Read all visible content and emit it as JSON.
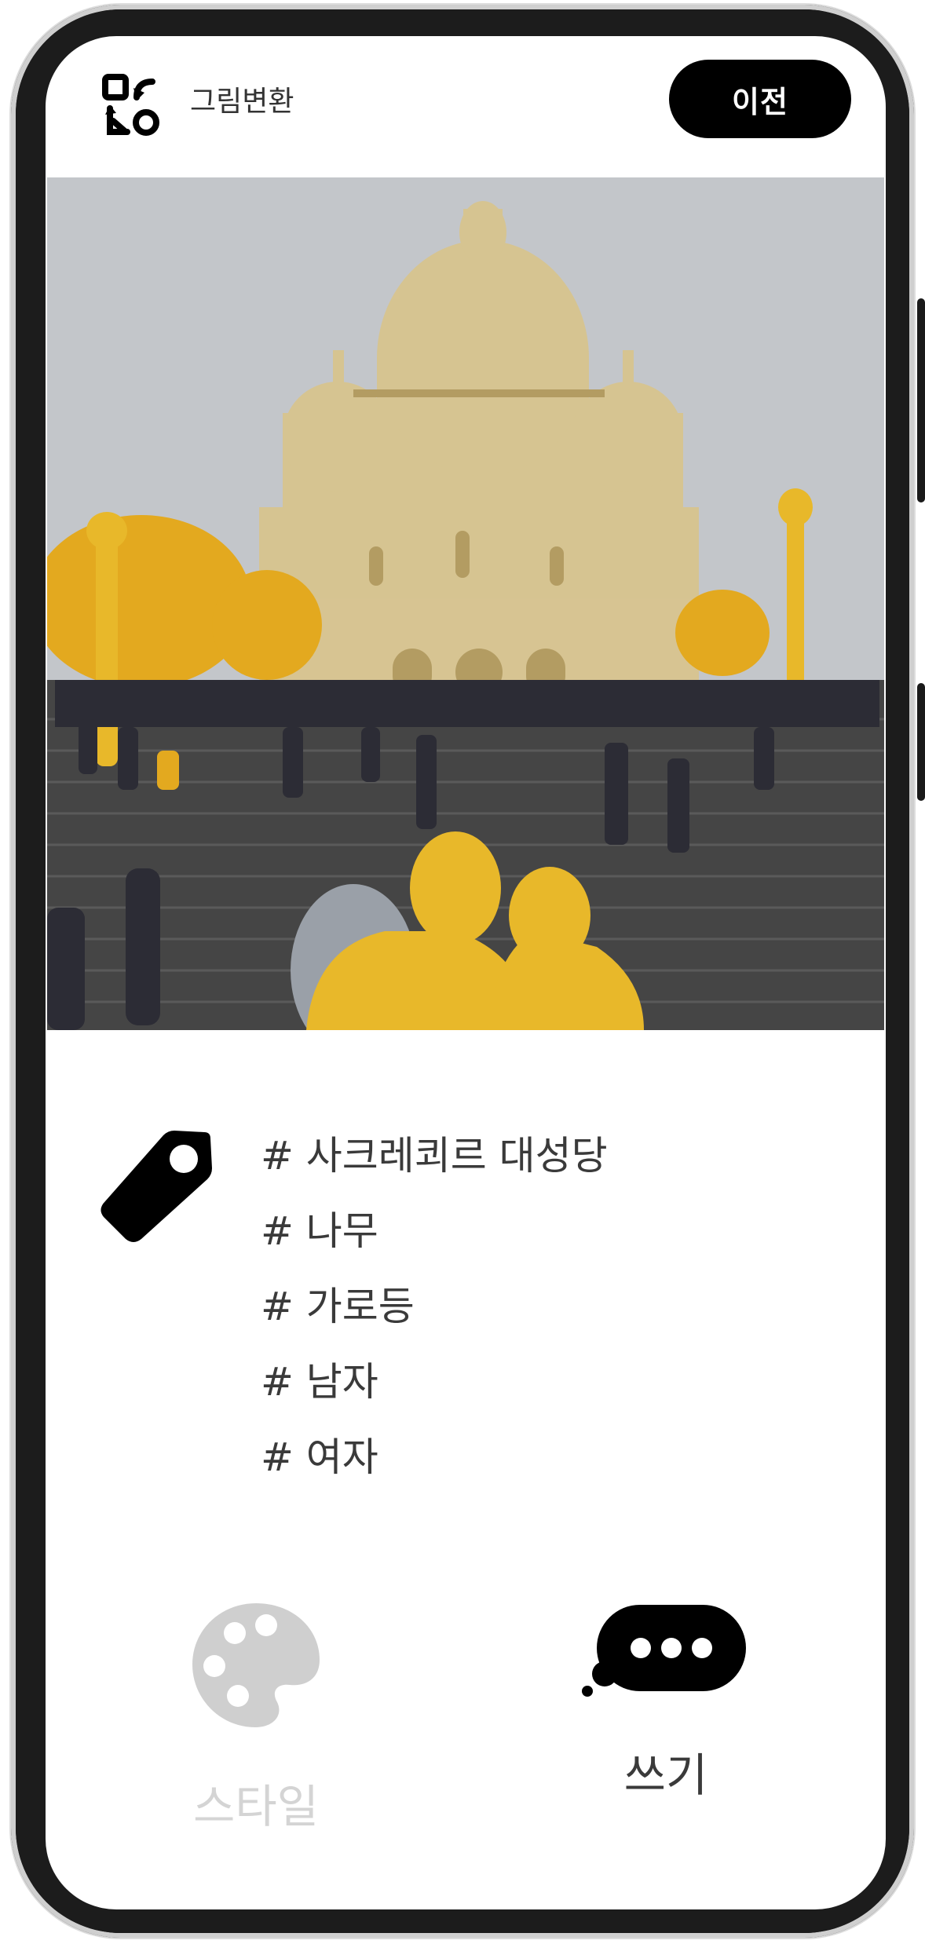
{
  "header": {
    "app_name": "그림변환",
    "back_label": "이전",
    "app_icon": "convert-icon"
  },
  "tags": {
    "icon": "tag-icon",
    "items": [
      "# 사크레쾨르 대성당",
      "# 나무",
      "# 가로등",
      "# 남자",
      "# 여자"
    ]
  },
  "bottom_tabs": {
    "style_label": "스타일",
    "style_icon": "palette-icon",
    "write_label": "쓰기",
    "write_icon": "chat-bubble-icon"
  },
  "colors": {
    "highlight": "#E8B82A",
    "active": "#000000",
    "inactive": "#D4D4D4"
  }
}
